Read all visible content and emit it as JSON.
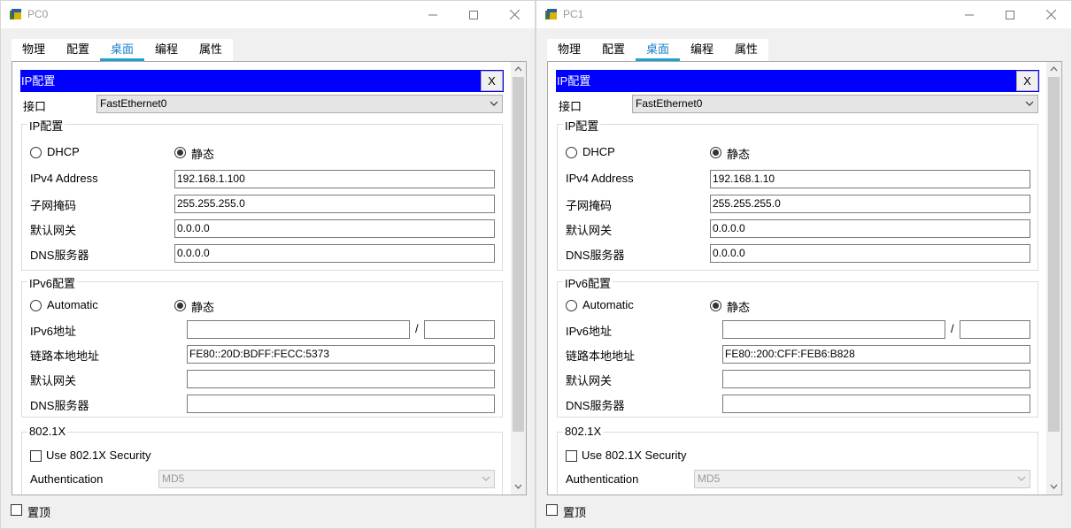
{
  "windows": [
    {
      "title": "PC0",
      "tabs": [
        "物理",
        "配置",
        "桌面",
        "编程",
        "属性"
      ],
      "active_tab": "桌面",
      "ip_config_title": "IP配置",
      "close_x": "X",
      "interface_label": "接口",
      "interface_value": "FastEthernet0",
      "ipv4_group_title": "IP配置",
      "dhcp_label": "DHCP",
      "static_label": "静态",
      "ipv4_address_label": "IPv4 Address",
      "ipv4_address": "192.168.1.100",
      "subnet_label": "子网掩码",
      "subnet_mask": "255.255.255.0",
      "gateway_label": "默认网关",
      "gateway": "0.0.0.0",
      "dns_label": "DNS服务器",
      "dns": "0.0.0.0",
      "ipv6_group_title": "IPv6配置",
      "ipv6_auto_label": "Automatic",
      "ipv6_static_label": "静态",
      "ipv6_address_label": "IPv6地址",
      "ipv6_address": "",
      "ipv6_prefix_sep": "/",
      "ipv6_prefix": "",
      "link_local_label": "链路本地地址",
      "link_local": "FE80::20D:BDFF:FECC:5373",
      "ipv6_gateway_label": "默认网关",
      "ipv6_gateway": "",
      "ipv6_dns_label": "DNS服务器",
      "ipv6_dns": "",
      "dot1x_group_title": "802.1X",
      "dot1x_use_label": "Use 802.1X Security",
      "auth_label": "Authentication",
      "auth_value": "MD5",
      "always_on_top_label": "置顶"
    },
    {
      "title": "PC1",
      "tabs": [
        "物理",
        "配置",
        "桌面",
        "编程",
        "属性"
      ],
      "active_tab": "桌面",
      "ip_config_title": "IP配置",
      "close_x": "X",
      "interface_label": "接口",
      "interface_value": "FastEthernet0",
      "ipv4_group_title": "IP配置",
      "dhcp_label": "DHCP",
      "static_label": "静态",
      "ipv4_address_label": "IPv4 Address",
      "ipv4_address": "192.168.1.10",
      "subnet_label": "子网掩码",
      "subnet_mask": "255.255.255.0",
      "gateway_label": "默认网关",
      "gateway": "0.0.0.0",
      "dns_label": "DNS服务器",
      "dns": "0.0.0.0",
      "ipv6_group_title": "IPv6配置",
      "ipv6_auto_label": "Automatic",
      "ipv6_static_label": "静态",
      "ipv6_address_label": "IPv6地址",
      "ipv6_address": "",
      "ipv6_prefix_sep": "/",
      "ipv6_prefix": "",
      "link_local_label": "链路本地地址",
      "link_local": "FE80::200:CFF:FEB6:B828",
      "ipv6_gateway_label": "默认网关",
      "ipv6_gateway": "",
      "ipv6_dns_label": "DNS服务器",
      "ipv6_dns": "",
      "dot1x_group_title": "802.1X",
      "dot1x_use_label": "Use 802.1X Security",
      "auth_label": "Authentication",
      "auth_value": "MD5",
      "always_on_top_label": "置顶"
    }
  ],
  "icons": {
    "app": "packet-tracer-app-icon",
    "minimize": "minimize-icon",
    "maximize": "maximize-icon",
    "close": "close-icon",
    "dropdown": "chevron-down-icon",
    "scroll_up": "scroll-up-arrow-icon",
    "scroll_down": "scroll-down-arrow-icon"
  },
  "colors": {
    "ip_config_bar": "#0000ff",
    "active_tab_text": "#1b7ec8",
    "active_tab_underline": "#1ba1d4"
  }
}
